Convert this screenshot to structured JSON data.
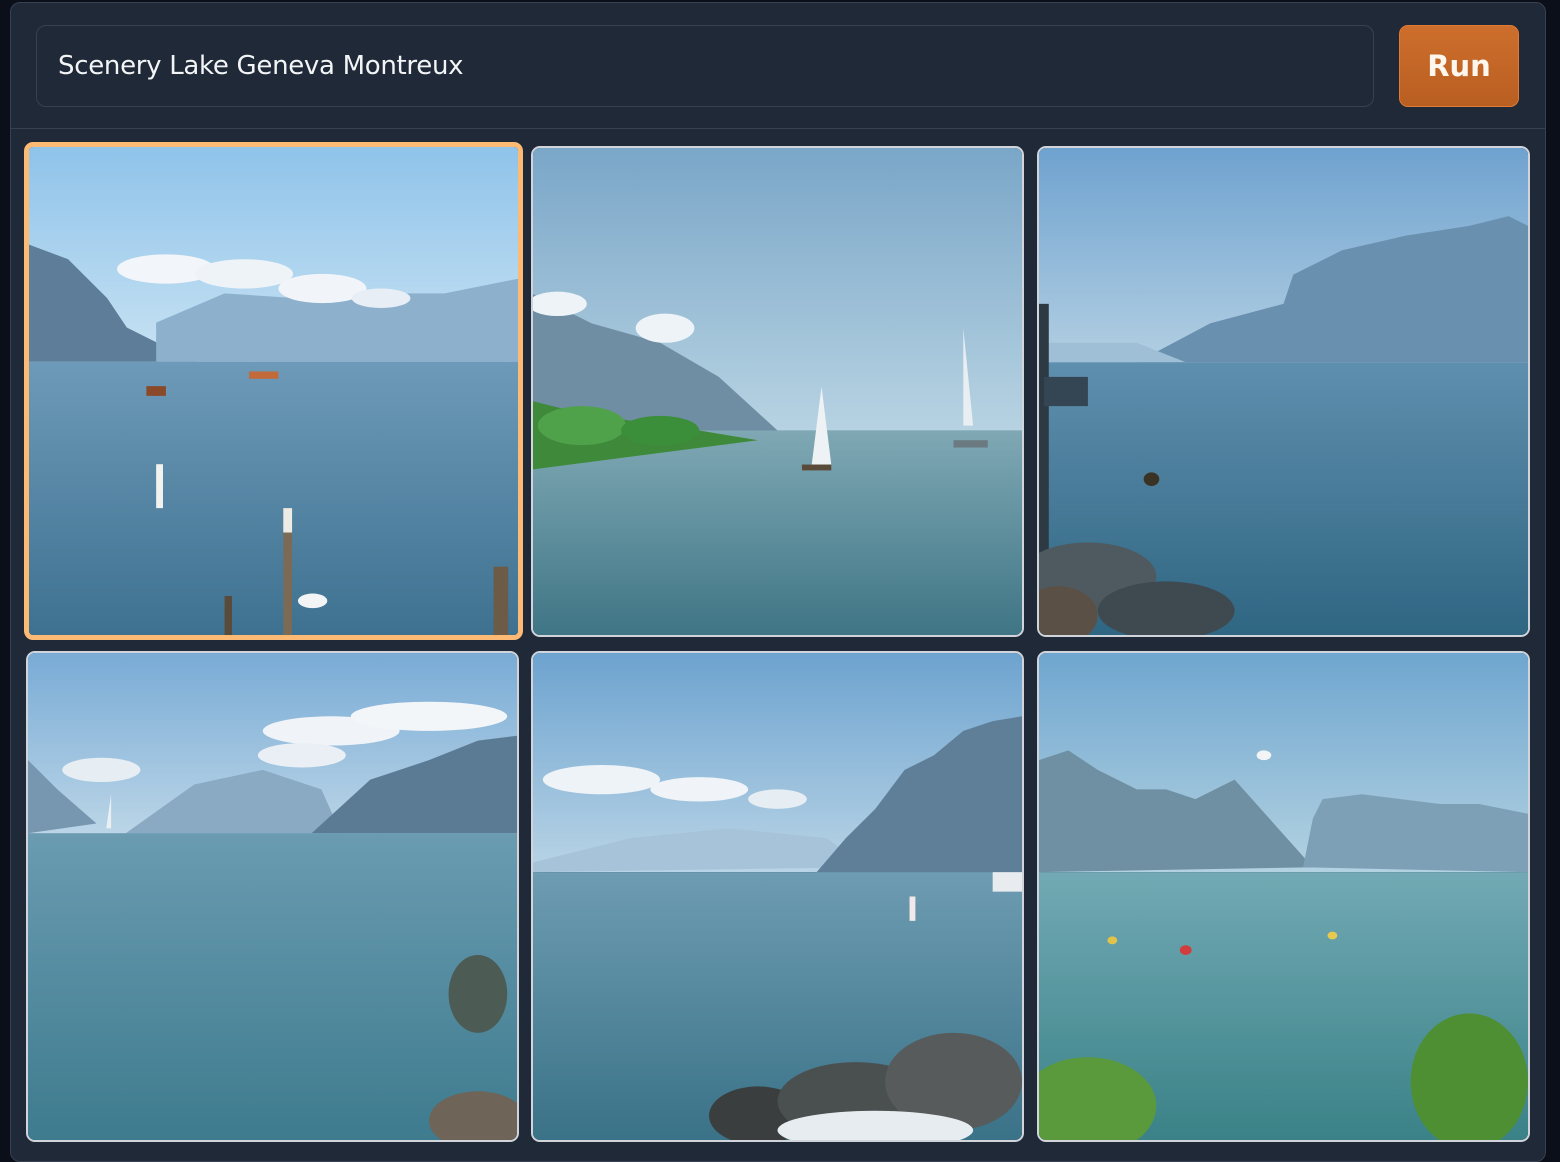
{
  "prompt": {
    "value": "Scenery Lake Geneva Montreux"
  },
  "run_button": {
    "label": "Run"
  },
  "gallery": {
    "selected_index": 0,
    "accent_color": "#fdba74",
    "images": [
      {
        "subject": "lake-with-mooring-posts"
      },
      {
        "subject": "lake-with-sailboats"
      },
      {
        "subject": "lake-with-rocky-shore"
      },
      {
        "subject": "lake-with-clouds-and-rocks"
      },
      {
        "subject": "lake-with-mountain-and-rocks"
      },
      {
        "subject": "lake-with-shrubs"
      }
    ]
  },
  "colors": {
    "background": "#0b0f19",
    "panel": "#1f2937",
    "run_button": "#c2662a"
  }
}
